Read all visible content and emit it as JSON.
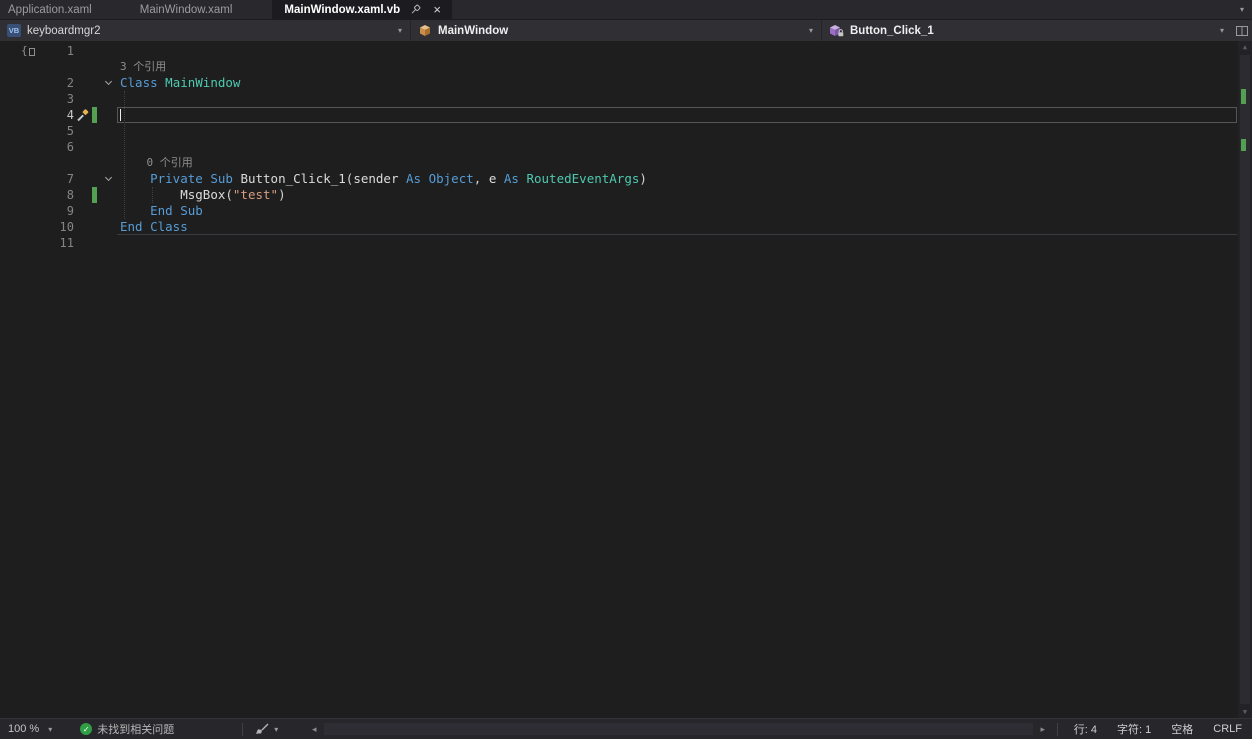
{
  "tabs": {
    "items": [
      {
        "label": "Application.xaml",
        "active": false
      },
      {
        "label": "MainWindow.xaml",
        "active": false
      },
      {
        "label": "MainWindow.xaml.vb",
        "active": true
      }
    ]
  },
  "navbar": {
    "project": "keyboardmgr2",
    "type": "MainWindow",
    "member": "Button_Click_1"
  },
  "editor": {
    "rows": [
      {
        "type": "code",
        "num": 1,
        "tokens": []
      },
      {
        "type": "codelens",
        "text": "3 个引用"
      },
      {
        "type": "code",
        "num": 2,
        "fold": true,
        "tokens": [
          {
            "t": "Class",
            "c": "kw"
          },
          {
            "t": " ",
            "c": "pl"
          },
          {
            "t": "MainWindow",
            "c": "ty"
          }
        ]
      },
      {
        "type": "code",
        "num": 3,
        "tokens": []
      },
      {
        "type": "code",
        "num": 4,
        "current": true,
        "caret": true,
        "changed": true,
        "quick_action": true,
        "tokens": []
      },
      {
        "type": "code",
        "num": 5,
        "tokens": []
      },
      {
        "type": "code",
        "num": 6,
        "tokens": []
      },
      {
        "type": "codelens",
        "text": "    0 个引用"
      },
      {
        "type": "code",
        "num": 7,
        "fold": true,
        "tokens": [
          {
            "t": "    ",
            "c": "pl"
          },
          {
            "t": "Private",
            "c": "kw"
          },
          {
            "t": " ",
            "c": "pl"
          },
          {
            "t": "Sub",
            "c": "kw"
          },
          {
            "t": " ",
            "c": "pl"
          },
          {
            "t": "Button_Click_1",
            "c": "id"
          },
          {
            "t": "(",
            "c": "pl"
          },
          {
            "t": "sender",
            "c": "id"
          },
          {
            "t": " ",
            "c": "pl"
          },
          {
            "t": "As",
            "c": "kw"
          },
          {
            "t": " ",
            "c": "pl"
          },
          {
            "t": "Object",
            "c": "kw"
          },
          {
            "t": ", ",
            "c": "pl"
          },
          {
            "t": "e",
            "c": "id"
          },
          {
            "t": " ",
            "c": "pl"
          },
          {
            "t": "As",
            "c": "kw"
          },
          {
            "t": " ",
            "c": "pl"
          },
          {
            "t": "RoutedEventArgs",
            "c": "ty"
          },
          {
            "t": ")",
            "c": "pl"
          }
        ]
      },
      {
        "type": "code",
        "num": 8,
        "changed": true,
        "tokens": [
          {
            "t": "        ",
            "c": "pl"
          },
          {
            "t": "MsgBox",
            "c": "id"
          },
          {
            "t": "(",
            "c": "pl"
          },
          {
            "t": "\"test\"",
            "c": "st"
          },
          {
            "t": ")",
            "c": "pl"
          }
        ]
      },
      {
        "type": "code",
        "num": 9,
        "tokens": [
          {
            "t": "    ",
            "c": "pl"
          },
          {
            "t": "End",
            "c": "kw"
          },
          {
            "t": " ",
            "c": "pl"
          },
          {
            "t": "Sub",
            "c": "kw"
          }
        ]
      },
      {
        "type": "code",
        "num": 10,
        "tokens": [
          {
            "t": "End",
            "c": "kw"
          },
          {
            "t": " ",
            "c": "pl"
          },
          {
            "t": "Class",
            "c": "kw"
          }
        ]
      },
      {
        "type": "code",
        "num": 11,
        "tokens": []
      }
    ],
    "colors": {
      "background": "#1e1e1e",
      "keyword": "#569cd6",
      "type_name": "#4ec9b0",
      "identifier": "#dcdcdc",
      "string": "#d69d85",
      "default_text": "#d4d4d4",
      "codelens": "#8f8f8f",
      "line_number": "#858585",
      "change_bar": "#53a053",
      "current_line_border": "#56565a"
    },
    "caret_line": 4
  },
  "statusbar": {
    "zoom": "100 %",
    "health": "未找到相关问题",
    "line": "行: 4",
    "char": "字符: 1",
    "spaces": "空格",
    "eol": "CRLF"
  },
  "icons": {
    "close": "×",
    "chevron_down": "▾",
    "check": "✓",
    "scroll_left": "◂",
    "scroll_right": "▸",
    "scroll_up": "▲",
    "scroll_down": "▼",
    "vb_badge": "VB",
    "outline_brace": "{",
    "pin": "pin-icon",
    "class": "class-cube-icon",
    "method": "method-cube-lock-icon",
    "quick_actions": "screwdriver-icon",
    "code_cleanup": "broom-icon",
    "split_window": "split-window-icon"
  }
}
